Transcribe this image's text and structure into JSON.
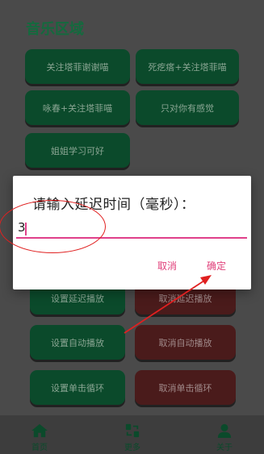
{
  "section_title": "音乐区域",
  "music_buttons": [
    "关注塔菲谢谢喵",
    "死疙瘩+关注塔菲喵",
    "咏春+关注塔菲喵",
    "只对你有感觉",
    "姐姐学习可好"
  ],
  "control_buttons": [
    {
      "left": "设置延迟播放",
      "right": "取消延迟播放"
    },
    {
      "left": "设置自动播放",
      "right": "取消自动播放"
    },
    {
      "left": "设置单击循环",
      "right": "取消单击循环"
    }
  ],
  "dialog": {
    "title": "请输入延迟时间（毫秒）：",
    "input_value": "3",
    "cancel_label": "取消",
    "confirm_label": "确定"
  },
  "nav": {
    "home": "首页",
    "update": "更多",
    "about": "关于"
  },
  "colors": {
    "accent": "#e0408a",
    "annotation": "#e02020",
    "green": "#0b4a2b",
    "red": "#4a1b1b"
  }
}
